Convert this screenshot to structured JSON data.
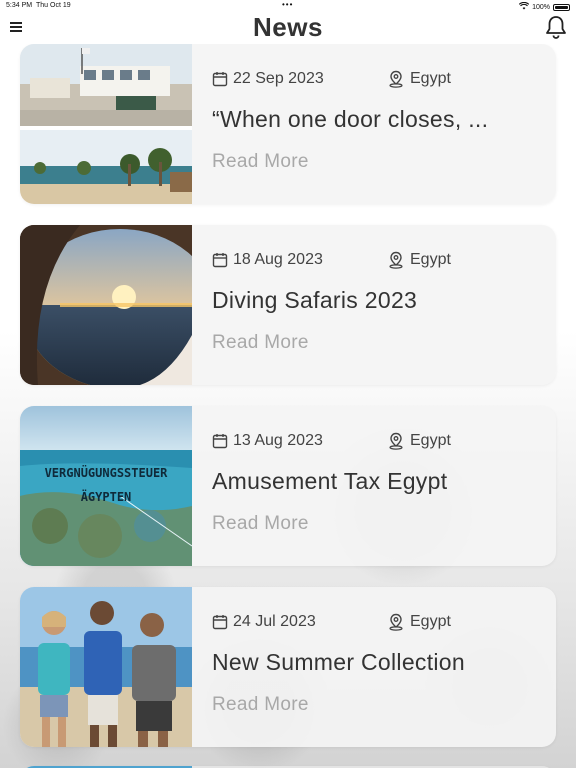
{
  "status_bar": {
    "time": "5:34 PM",
    "date": "Thu Oct 19",
    "dots": "•••",
    "battery_text": "100%"
  },
  "header": {
    "title": "News"
  },
  "news": [
    {
      "date": "22 Sep 2023",
      "location": "Egypt",
      "title": "“When one door closes, ...",
      "read_more": "Read More",
      "image": "beach-buildings-photo"
    },
    {
      "date": "18 Aug 2023",
      "location": "Egypt",
      "title": "Diving Safaris 2023",
      "read_more": "Read More",
      "image": "sunset-porthole-photo"
    },
    {
      "date": "13 Aug 2023",
      "location": "Egypt",
      "title": "Amusement Tax Egypt",
      "read_more": "Read More",
      "image": "reef-photo",
      "image_text": [
        "VERGNÜGUNGSSTEUER",
        "ÄGYPTEN"
      ]
    },
    {
      "date": "24 Jul 2023",
      "location": "Egypt",
      "title": "New Summer Collection",
      "read_more": "Read More",
      "image": "three-people-photo"
    }
  ],
  "colors": {
    "title_text": "#333333",
    "read_more": "#a8a8a8",
    "card_bg": "#f4f4f4"
  },
  "icons": {
    "menu": "hamburger-icon",
    "bell": "bell-icon",
    "calendar": "calendar-icon",
    "location": "location-pin-icon"
  }
}
